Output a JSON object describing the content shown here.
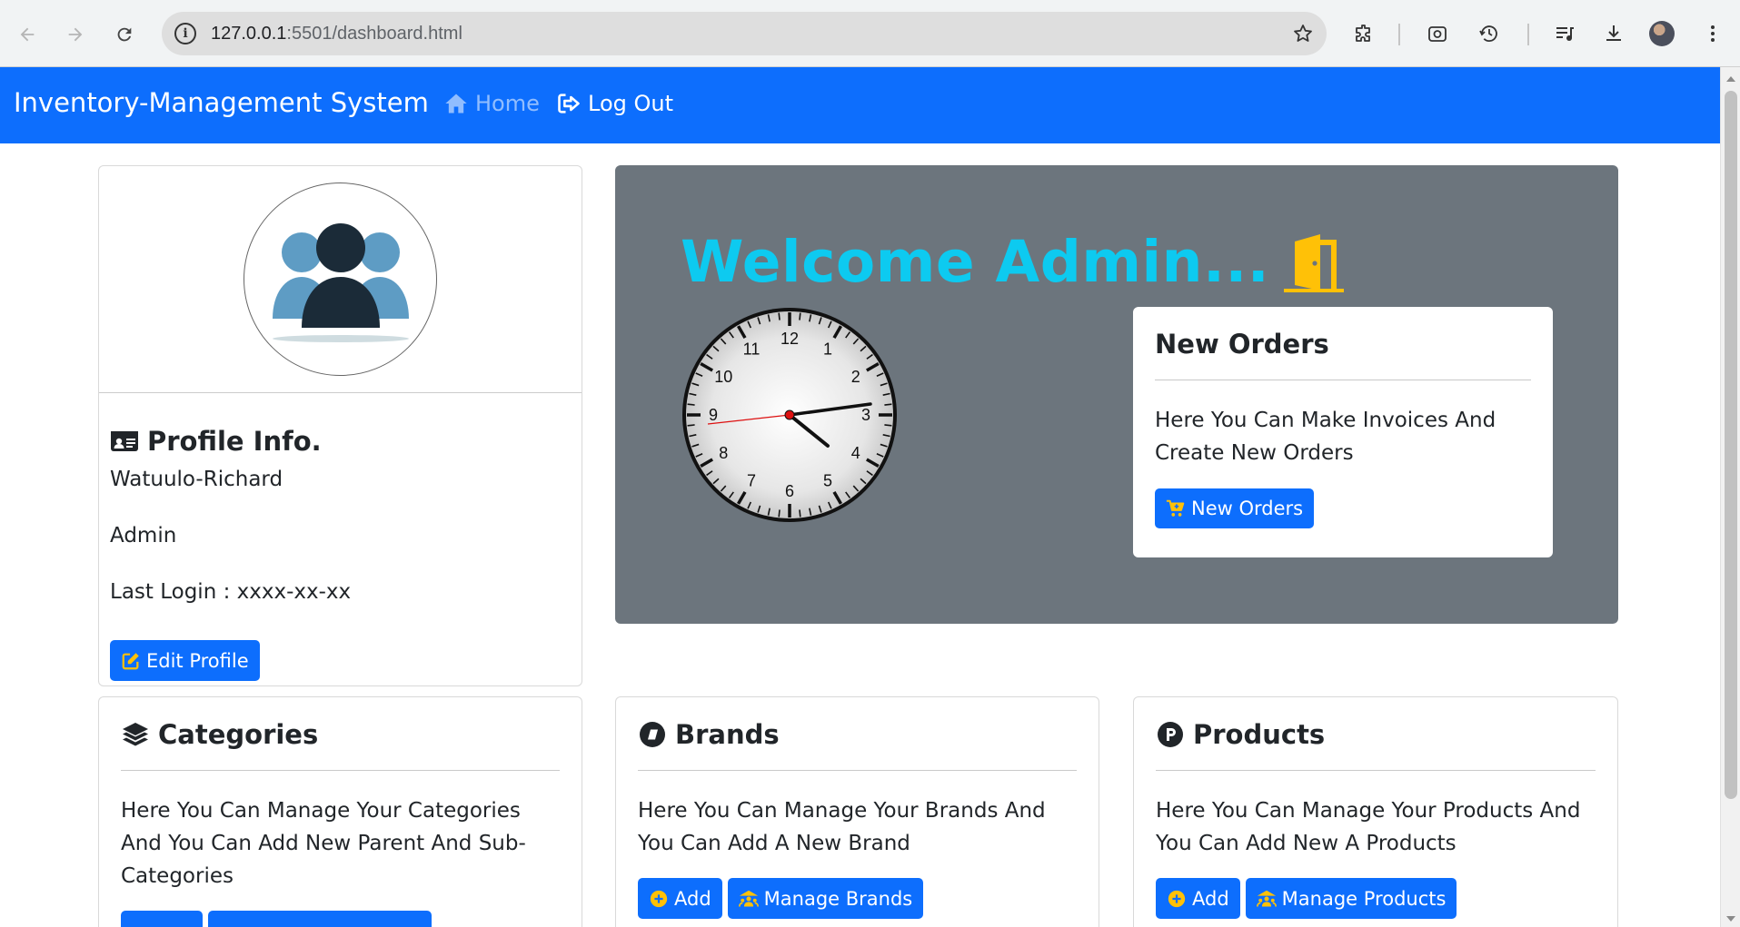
{
  "browser": {
    "url_host": "127.0.0.1",
    "url_path": ":5501/dashboard.html"
  },
  "navbar": {
    "brand": "Inventory-Management System",
    "home_label": "Home",
    "logout_label": "Log Out"
  },
  "profile": {
    "title": "Profile Info.",
    "name": "Watuulo-Richard",
    "role": "Admin",
    "last_login": "Last Login : xxxx-xx-xx",
    "edit_button": "Edit Profile"
  },
  "welcome": {
    "title": "Welcome Admin...",
    "clock_numbers": [
      "12",
      "1",
      "2",
      "3",
      "4",
      "5",
      "6",
      "7",
      "8",
      "9",
      "10",
      "11"
    ]
  },
  "orders": {
    "title": "New Orders",
    "text": "Here You Can Make Invoices And Create New Orders",
    "button": "New Orders"
  },
  "categories": {
    "title": "Categories",
    "text": "Here You Can Manage Your Categories And You Can Add New Parent And Sub-Categories"
  },
  "brands": {
    "title": "Brands",
    "text": "Here You Can Manage Your Brands And You Can Add A New Brand",
    "add_button": "Add",
    "manage_button": "Manage Brands"
  },
  "products": {
    "title": "Products",
    "text": "Here You Can Manage Your Products And You Can Add New A Products",
    "add_button": "Add",
    "manage_button": "Manage Products"
  },
  "colors": {
    "primary": "#0d6efd",
    "panel": "#6c757d",
    "welcome_text": "#0dcaf0",
    "icon_accent": "#ffc107"
  }
}
